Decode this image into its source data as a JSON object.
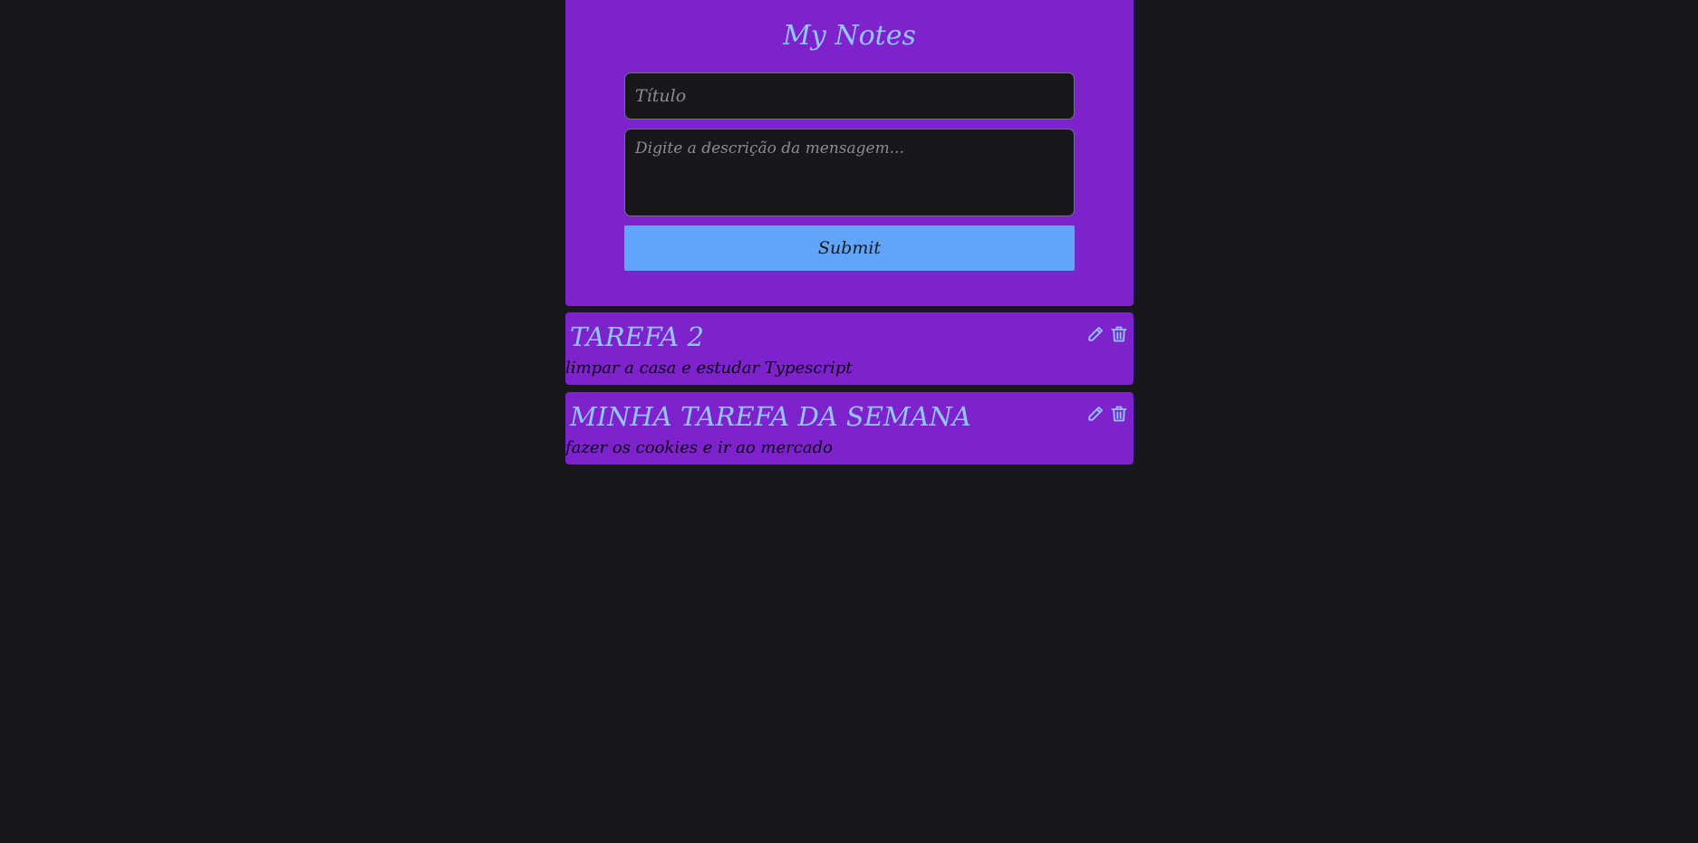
{
  "app": {
    "title": "My Notes"
  },
  "form": {
    "title_placeholder": "Título",
    "title_value": "",
    "description_placeholder": "Digite a descrição da mensagem...",
    "description_value": "",
    "submit_label": "Submit"
  },
  "notes": [
    {
      "title": "TAREFA 2",
      "description": "limpar a casa e estudar Typescript",
      "edit_icon": "pencil-icon",
      "delete_icon": "trash-icon"
    },
    {
      "title": "MINHA TAREFA DA SEMANA",
      "description": "fazer os cookies e ir ao mercado",
      "edit_icon": "pencil-icon",
      "delete_icon": "trash-icon"
    }
  ],
  "colors": {
    "background": "#18181b",
    "card": "#7e22ce",
    "accent": "#93c5fd",
    "button": "#60a5fa"
  }
}
